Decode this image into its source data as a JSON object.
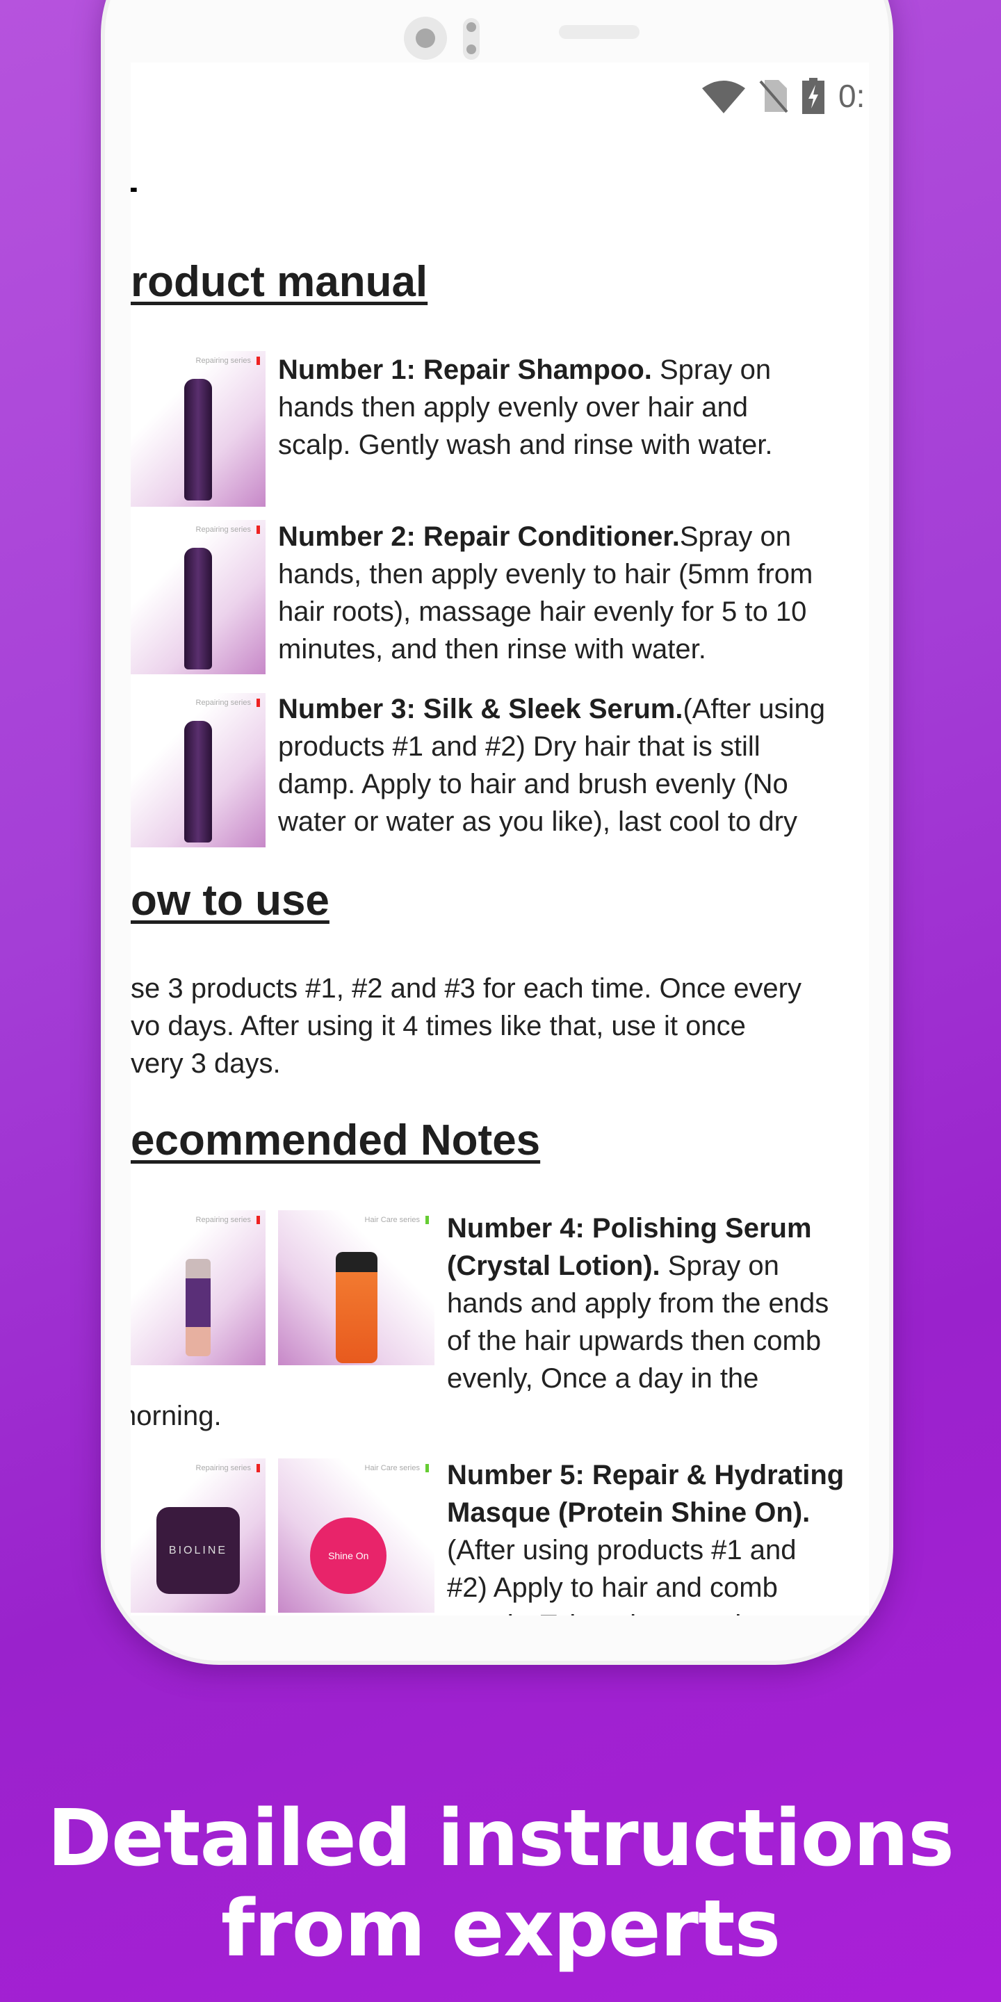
{
  "status_bar": {
    "icons": [
      "wifi-icon",
      "no-sim-icon",
      "battery-charging-icon"
    ],
    "time": "0:"
  },
  "top_fragment": "-",
  "sections": {
    "manual_heading": "roduct manual",
    "items": [
      {
        "title": "Number 1: Repair Shampoo.",
        "lines": [
          " Spray on",
          "hands then apply evenly over hair and",
          "scalp. Gently wash and rinse with water."
        ],
        "image_label": "Repairing series"
      },
      {
        "title": "Number 2: Repair Conditioner.",
        "lines": [
          "Spray on",
          "hands, then apply evenly to hair (5mm from",
          "hair roots), massage hair evenly for 5 to 10",
          "minutes, and then rinse with water."
        ],
        "image_label": "Repairing series"
      },
      {
        "title": "Number 3: Silk & Sleek Serum.",
        "lines": [
          "(After using",
          "products #1 and #2) Dry hair that is still",
          "damp. Apply to hair and brush evenly (No",
          "water or water as you like), last cool to dry"
        ],
        "image_label": "Repairing series"
      }
    ],
    "howto_heading": "ow to use",
    "howto_lines": [
      "se 3 products #1, #2 and #3 for each time. Once every",
      "vo days. After using it 4 times like that, use it once",
      "very 3 days."
    ],
    "notes_heading": "ecommended Notes",
    "notes": [
      {
        "title_lines": [
          "Number 4: Polishing Serum",
          "(Crystal Lotion)."
        ],
        "lines": [
          " Spray on",
          "hands and apply from the ends",
          "of the hair upwards then comb",
          "evenly, Once a day in the"
        ],
        "tail": "norning.",
        "image_labels": [
          "Repairing series",
          "Hair Care series"
        ]
      },
      {
        "title_lines": [
          "Number 5: Repair & Hydrating",
          "Masque (Protein Shine On)."
        ],
        "lines": [
          "(After using products #1 and",
          "#2) Apply to hair and comb",
          "evenly. Take a hot towel to"
        ],
        "image_labels": [
          "Repairing series",
          "Hair Care series"
        ],
        "brand": "BIOLINE",
        "product": "Shine On"
      }
    ]
  },
  "caption": {
    "line1": "Detailed instructions",
    "line2": "from experts"
  },
  "colors": {
    "background": "#a43ed6",
    "text": "#222222",
    "caption": "#ffffff"
  }
}
